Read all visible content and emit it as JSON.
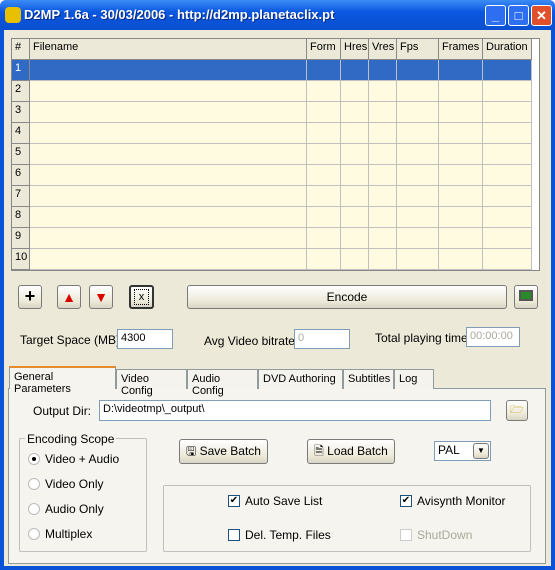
{
  "window": {
    "title": "D2MP 1.6a - 30/03/2006 - http://d2mp.planetaclix.pt",
    "minimize": "_",
    "maximize": "□",
    "close": "✕"
  },
  "grid": {
    "columns": [
      "#",
      "Filename",
      "Form",
      "Hres",
      "Vres",
      "Fps",
      "Frames",
      "Duration"
    ],
    "rows": [
      "1",
      "2",
      "3",
      "4",
      "5",
      "6",
      "7",
      "8",
      "9",
      "10"
    ],
    "selected_row": "1"
  },
  "toolbar": {
    "add": "+",
    "encode": "Encode",
    "clear": "x"
  },
  "stats": {
    "target_label": "Target Space (MB):",
    "target_value": "4300",
    "bitrate_label": "Avg Video bitrate:",
    "bitrate_value": "0",
    "time_label": "Total playing time:",
    "time_value": "00:00:00"
  },
  "tabs": [
    "General Parameters",
    "Video Config",
    "Audio Config",
    "DVD Authoring",
    "Subtitles",
    "Log"
  ],
  "general": {
    "output_label": "Output Dir:",
    "output_value": "D:\\videotmp\\_output\\",
    "scope_title": "Encoding Scope",
    "scope_options": [
      "Video + Audio",
      "Video Only",
      "Audio Only",
      "Multiplex"
    ],
    "scope_selected": "Video + Audio",
    "save_batch": "Save Batch",
    "load_batch": "Load Batch",
    "format": "PAL",
    "options": [
      {
        "label": "Auto Save List",
        "checked": true,
        "enabled": true
      },
      {
        "label": "Avisynth Monitor",
        "checked": true,
        "enabled": true
      },
      {
        "label": "Del. Temp. Files",
        "checked": false,
        "enabled": true
      },
      {
        "label": "ShutDown",
        "checked": false,
        "enabled": false
      }
    ]
  },
  "colors": {
    "selection": "#316AC5",
    "row_bg": "#FFFBE0",
    "title_bar": "#0A57E0"
  }
}
